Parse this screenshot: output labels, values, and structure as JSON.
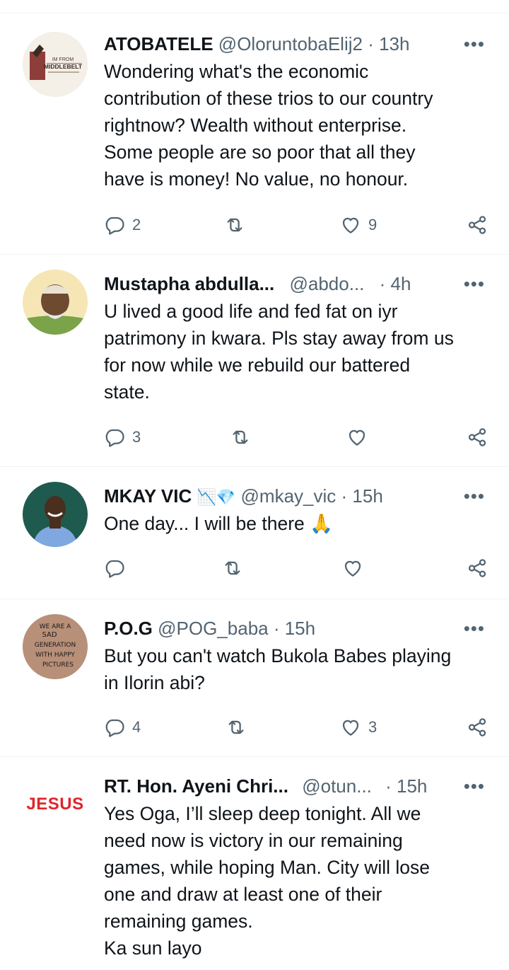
{
  "tweets": [
    {
      "name": "ATOBATELE",
      "handle": "@OloruntobaElij2",
      "time": "· 13h",
      "text_lines": [
        "Wondering what's the economic",
        "contribution of these trios to our country",
        "rightnow? Wealth without enterprise.",
        "Some people are so poor that all they",
        "have is money! No value, no honour."
      ],
      "replies": "2",
      "reposts": "",
      "likes": "9",
      "avatar_text": [
        "IM FROM",
        "MIDDLEBELT"
      ]
    },
    {
      "name": "Mustapha abdulla...",
      "handle": "@abdo...",
      "time": "· 4h",
      "text_lines": [
        "U lived a good life and fed fat on iyr",
        "patrimony in kwara. Pls stay away from us",
        "for now while we rebuild our battered",
        "state."
      ],
      "replies": "3",
      "reposts": "",
      "likes": ""
    },
    {
      "name": "MKAY VIC",
      "badges": "📉💎",
      "handle": "@mkay_vic",
      "time": "· 15h",
      "text_lines": [
        "One day... I will be there 🙏"
      ],
      "replies": "",
      "reposts": "",
      "likes": ""
    },
    {
      "name": "P.O.G",
      "handle": "@POG_baba",
      "time": "· 15h",
      "text_lines": [
        "But you can't watch Bukola Babes playing",
        "in Ilorin abi?"
      ],
      "replies": "4",
      "reposts": "",
      "likes": "3",
      "avatar_text": [
        "WE ARE A",
        "SAD",
        "GENERATION",
        "WITH HAPPY",
        "PICTURES"
      ]
    },
    {
      "name": "RT. Hon. Ayeni Chri...",
      "handle": "@otun...",
      "time": "· 15h",
      "text_lines": [
        "Yes Oga, I’ll sleep deep tonight. All we",
        "need now is victory in our remaining",
        "games, while hoping Man. City will lose",
        "one and draw at least one of their",
        "remaining games.",
        "Ka sun layo"
      ],
      "replies": "",
      "reposts": "",
      "likes": "",
      "avatar_text": [
        "JESUS"
      ]
    }
  ],
  "more_label": "•••",
  "icons": {
    "reply": "reply-icon",
    "repost": "repost-icon",
    "like": "heart-icon",
    "share": "share-icon"
  },
  "colors": {
    "text": "#0f1419",
    "secondary": "#536471",
    "divider": "#eff3f4",
    "jesus_red": "#e0242b"
  }
}
